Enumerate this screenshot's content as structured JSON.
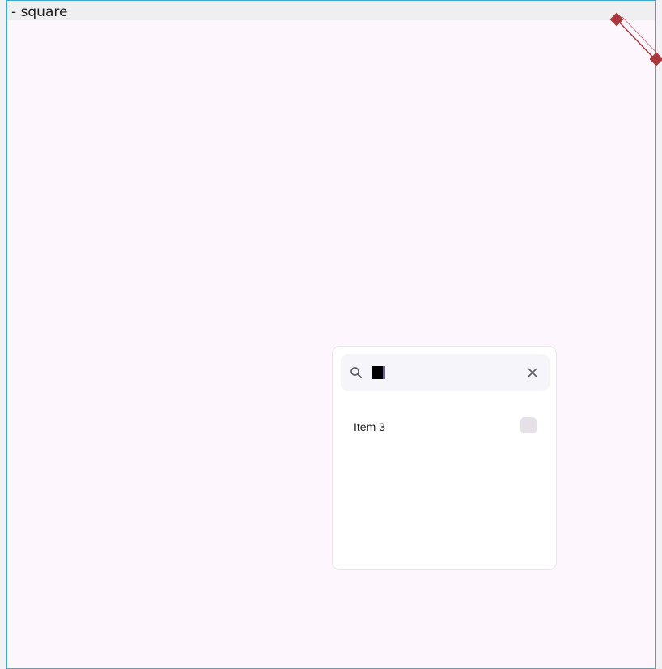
{
  "window": {
    "title": "- square"
  },
  "search": {
    "value": "",
    "placeholder": ""
  },
  "list": {
    "items": [
      {
        "label": "Item 3",
        "checked": false
      }
    ]
  },
  "icons": {
    "search": "search-icon",
    "clear": "close-icon",
    "resize": "resize-handle-icon"
  },
  "colors": {
    "frame_border": "#3aa8d8",
    "background": "#fdf7fd",
    "handle": "#a8383e",
    "search_field": "#f6f5f9",
    "checkbox": "#e6e1e8"
  }
}
